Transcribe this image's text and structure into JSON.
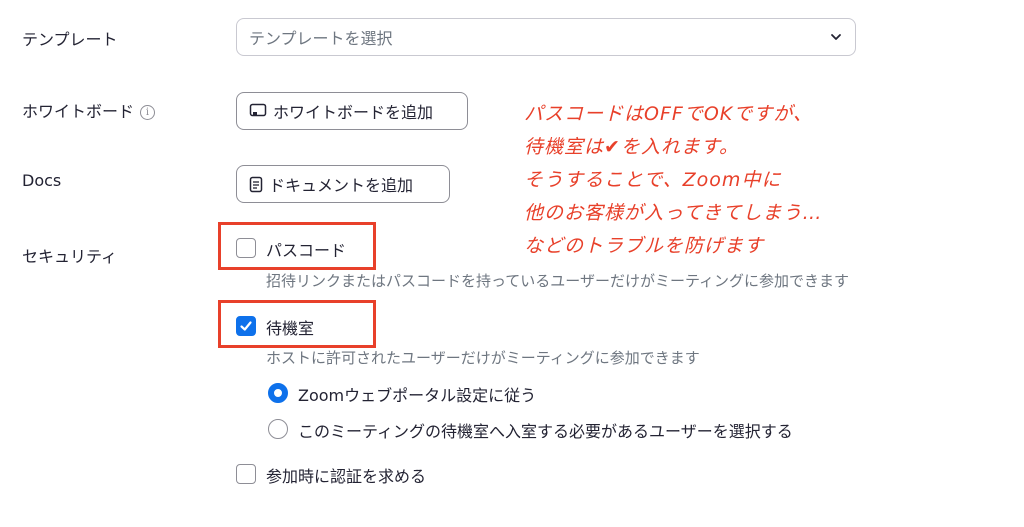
{
  "template": {
    "label": "テンプレート",
    "select_value": "テンプレートを選択",
    "icon": "chevron-down-icon"
  },
  "whiteboard": {
    "label": "ホワイトボード",
    "info_icon": "i",
    "button_label": "ホワイトボードを追加",
    "icon": "whiteboard-icon"
  },
  "docs": {
    "label": "Docs",
    "button_label": "ドキュメントを追加",
    "icon": "document-icon"
  },
  "security": {
    "label": "セキュリティ",
    "passcode": {
      "label": "パスコード",
      "checked": false,
      "description": "招待リンクまたはパスコードを持っているユーザーだけがミーティングに参加できます"
    },
    "waiting_room": {
      "label": "待機室",
      "checked": true,
      "description": "ホストに許可されたユーザーだけがミーティングに参加できます",
      "options": [
        {
          "label": "Zoomウェブポータル設定に従う",
          "selected": true
        },
        {
          "label": "このミーティングの待機室へ入室する必要があるユーザーを選択する",
          "selected": false
        }
      ]
    },
    "auth": {
      "label": "参加時に認証を求める",
      "checked": false
    }
  },
  "annotation": {
    "color": "#e8402a",
    "lines": [
      "パスコードはOFFでOKですが、",
      "待機室は✔を入れます。",
      "そうすることで、Zoom中に",
      "他のお客様が入ってきてしまう…",
      "などのトラブルを防げます"
    ]
  },
  "colors": {
    "accent": "#0e71eb",
    "highlight": "#e8402a",
    "text": "#232333",
    "muted": "#6e7680"
  }
}
